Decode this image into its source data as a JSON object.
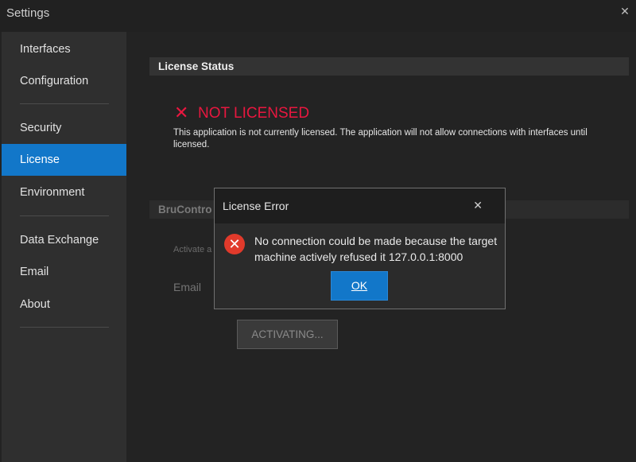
{
  "window": {
    "title": "Settings",
    "close_icon": "close-icon"
  },
  "sidebar": {
    "items": [
      {
        "label": "Interfaces",
        "active": false
      },
      {
        "label": "Configuration",
        "active": false
      },
      {
        "label": "Security",
        "active": false
      },
      {
        "label": "License",
        "active": true
      },
      {
        "label": "Environment",
        "active": false
      },
      {
        "label": "Data Exchange",
        "active": false
      },
      {
        "label": "Email",
        "active": false
      },
      {
        "label": "About",
        "active": false
      }
    ]
  },
  "license": {
    "section_title": "License Status",
    "status_icon": "x-icon",
    "status_text": "NOT LICENSED",
    "status_color": "#e8173f",
    "description": "This application is not currently licensed. The application will not allow connections with interfaces until licensed."
  },
  "activation": {
    "section_title_partial": "BruContro",
    "activate_text_partial": "Activate a",
    "email_label": "Email",
    "activating_button": "ACTIVATING..."
  },
  "dialog": {
    "title": "License Error",
    "close_icon": "close-icon",
    "icon": "error-icon",
    "message": "No connection could be made because the target machine actively refused it 127.0.0.1:8000",
    "ok_label": "OK"
  },
  "colors": {
    "accent": "#1277c9",
    "error": "#e13a2b"
  }
}
